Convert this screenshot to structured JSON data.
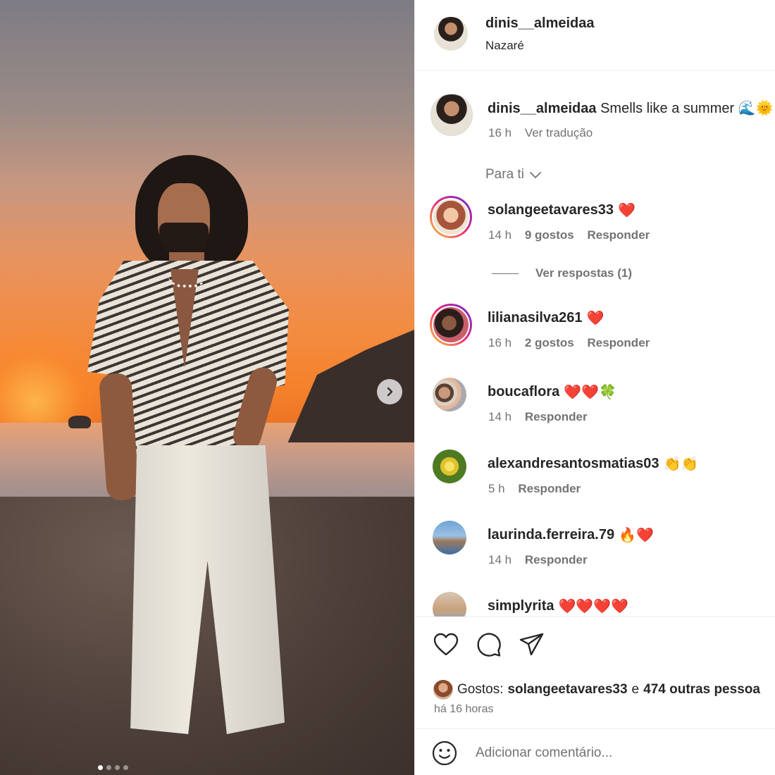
{
  "post": {
    "username": "dinis__almeidaa",
    "location": "Nazaré",
    "caption_text": "Smells like a summer",
    "caption_emojis": "🌊🌞",
    "caption_time": "16 h",
    "translate_label": "Ver tradução",
    "carousel": {
      "current": 1,
      "total": 4
    }
  },
  "sort": {
    "label": "Para ti"
  },
  "comments": [
    {
      "username": "solangeetavares33",
      "emoji": "❤️",
      "time": "14 h",
      "likes": "9 gostos",
      "reply": "Responder",
      "view_replies": "Ver respostas (1)"
    },
    {
      "username": "lilianasilva261",
      "emoji": "❤️",
      "time": "16 h",
      "likes": "2 gostos",
      "reply": "Responder"
    },
    {
      "username": "boucaflora",
      "emoji": "❤️❤️🍀",
      "time": "14 h",
      "reply": "Responder"
    },
    {
      "username": "alexandresantosmatias03",
      "emoji": "👏👏",
      "time": "5 h",
      "reply": "Responder"
    },
    {
      "username": "laurinda.ferreira.79",
      "emoji": "🔥❤️",
      "time": "14 h",
      "reply": "Responder"
    },
    {
      "username": "simplyrita",
      "emoji": "❤️❤️❤️❤️"
    }
  ],
  "likes_line": {
    "prefix": "Gostos:",
    "first_user": "solangeetavares33",
    "connector": "e",
    "others": "474 outras pessoa"
  },
  "post_time": "há 16 horas",
  "add_comment": {
    "placeholder": "Adicionar comentário..."
  },
  "icons": {
    "like": "heart-outline-icon",
    "comment": "speech-bubble-icon",
    "share": "paper-plane-icon",
    "emoji_picker": "smiley-icon",
    "next": "chevron-right-icon"
  },
  "colors": {
    "text": "#262626",
    "secondary": "#737373",
    "heart": "#ed4956"
  }
}
